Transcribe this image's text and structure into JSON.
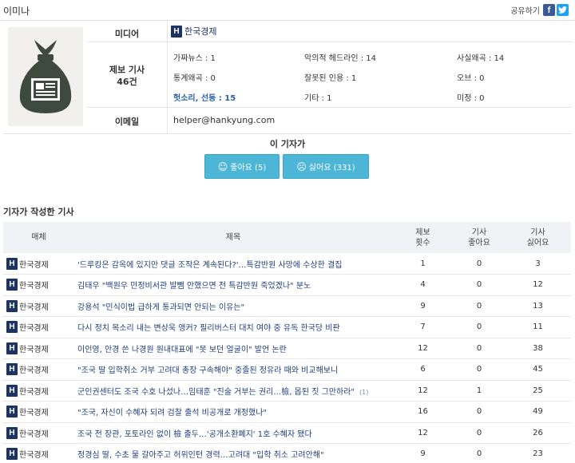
{
  "reporter": {
    "name": "이미나"
  },
  "share": {
    "label": "공유하기",
    "facebook_icon": "f",
    "twitter_icon": "t"
  },
  "profile": {
    "media_label": "미디어",
    "media_badge": "H",
    "media_name": "한국경제",
    "report_label": "제보 기사",
    "report_count": "46건",
    "email_label": "이메일",
    "email": "helper@hankyung.com",
    "stats": [
      {
        "label": "가짜뉴스 : 1",
        "highlight": false
      },
      {
        "label": "악의적 헤드라인 : 14",
        "highlight": false
      },
      {
        "label": "사실왜곡 : 14",
        "highlight": false
      },
      {
        "label": "통계왜곡 : 0",
        "highlight": false
      },
      {
        "label": "잘못된 인용 : 1",
        "highlight": false
      },
      {
        "label": "오브 : 0",
        "highlight": false
      },
      {
        "label": "헛소리, 선동 : 15",
        "highlight": true
      },
      {
        "label": "기타 : 1",
        "highlight": false
      },
      {
        "label": "미정 : 0",
        "highlight": false
      }
    ]
  },
  "vote": {
    "title": "이 기자가",
    "like_label": "좋아요 (5)",
    "dislike_label": "싫어요 (331)",
    "like_count": 5,
    "dislike_count": 331,
    "accent": "#4db6d6"
  },
  "articles": {
    "section_title": "기자가 작성한 기사",
    "headers": {
      "media": "매체",
      "title": "제목",
      "reports": "제보\n횟수",
      "likes": "기사\n좋아요",
      "dislikes": "기사\n싫어요"
    },
    "rows": [
      {
        "badge": "H",
        "media": "한국경제",
        "title": "'드루킹은 감옥에 있지만 댓글 조작은 계속된다?'…특감반원 사망에 수상한 결집",
        "comments": "",
        "reports": "1",
        "likes": "0",
        "dislikes": "3"
      },
      {
        "badge": "H",
        "media": "한국경제",
        "title": "김태우 \"백원우 민정비서관 발뺌 안했으면 전 특감반원 죽었겠나\" 분노",
        "comments": "",
        "reports": "4",
        "likes": "0",
        "dislikes": "12"
      },
      {
        "badge": "H",
        "media": "한국경제",
        "title": "강용석 \"민식이법 급하게 통과되면 안되는 이유는\"",
        "comments": "",
        "reports": "9",
        "likes": "0",
        "dislikes": "13"
      },
      {
        "badge": "H",
        "media": "한국경제",
        "title": "다시 정치 목소리 내는 변상욱 앵커? 필리버스터 대치 여야 중 유독 한국당 비판",
        "comments": "",
        "reports": "7",
        "likes": "0",
        "dislikes": "11"
      },
      {
        "badge": "H",
        "media": "한국경제",
        "title": "이인영, 안경 쓴 나경원 원내대표에 \"못 보던 얼굴이\" 발언 논란",
        "comments": "",
        "reports": "12",
        "likes": "0",
        "dislikes": "38"
      },
      {
        "badge": "H",
        "media": "한국경제",
        "title": "\"조국 딸 입학취소 거부 고려대 총장 구속해야\" 중졸된 정유라 때와 비교해보니",
        "comments": "",
        "reports": "6",
        "likes": "0",
        "dislikes": "45"
      },
      {
        "badge": "H",
        "media": "한국경제",
        "title": "군인권센터도 조국 수호 나섰나…임태훈 \"진술 거부는 권리…檢, 몹된 짓 그만하라\"",
        "comments": "(1)",
        "reports": "12",
        "likes": "1",
        "dislikes": "25"
      },
      {
        "badge": "H",
        "media": "한국경제",
        "title": "\"조국, 자신이 수혜자 되려 검찰 출석 비공개로 개정했나\"",
        "comments": "",
        "reports": "16",
        "likes": "0",
        "dislikes": "49"
      },
      {
        "badge": "H",
        "media": "한국경제",
        "title": "조국 전 장관, 포토라인 없이 檢 출두…'공개소환폐지' 1호 수혜자 됐다",
        "comments": "",
        "reports": "12",
        "likes": "0",
        "dislikes": "26"
      },
      {
        "badge": "H",
        "media": "한국경제",
        "title": "정경심 딸, 수초 물 갈아주고 허위인턴 경력…고려대 \"입학 취소 고려안해\"",
        "comments": "",
        "reports": "9",
        "likes": "0",
        "dislikes": "23"
      }
    ]
  }
}
